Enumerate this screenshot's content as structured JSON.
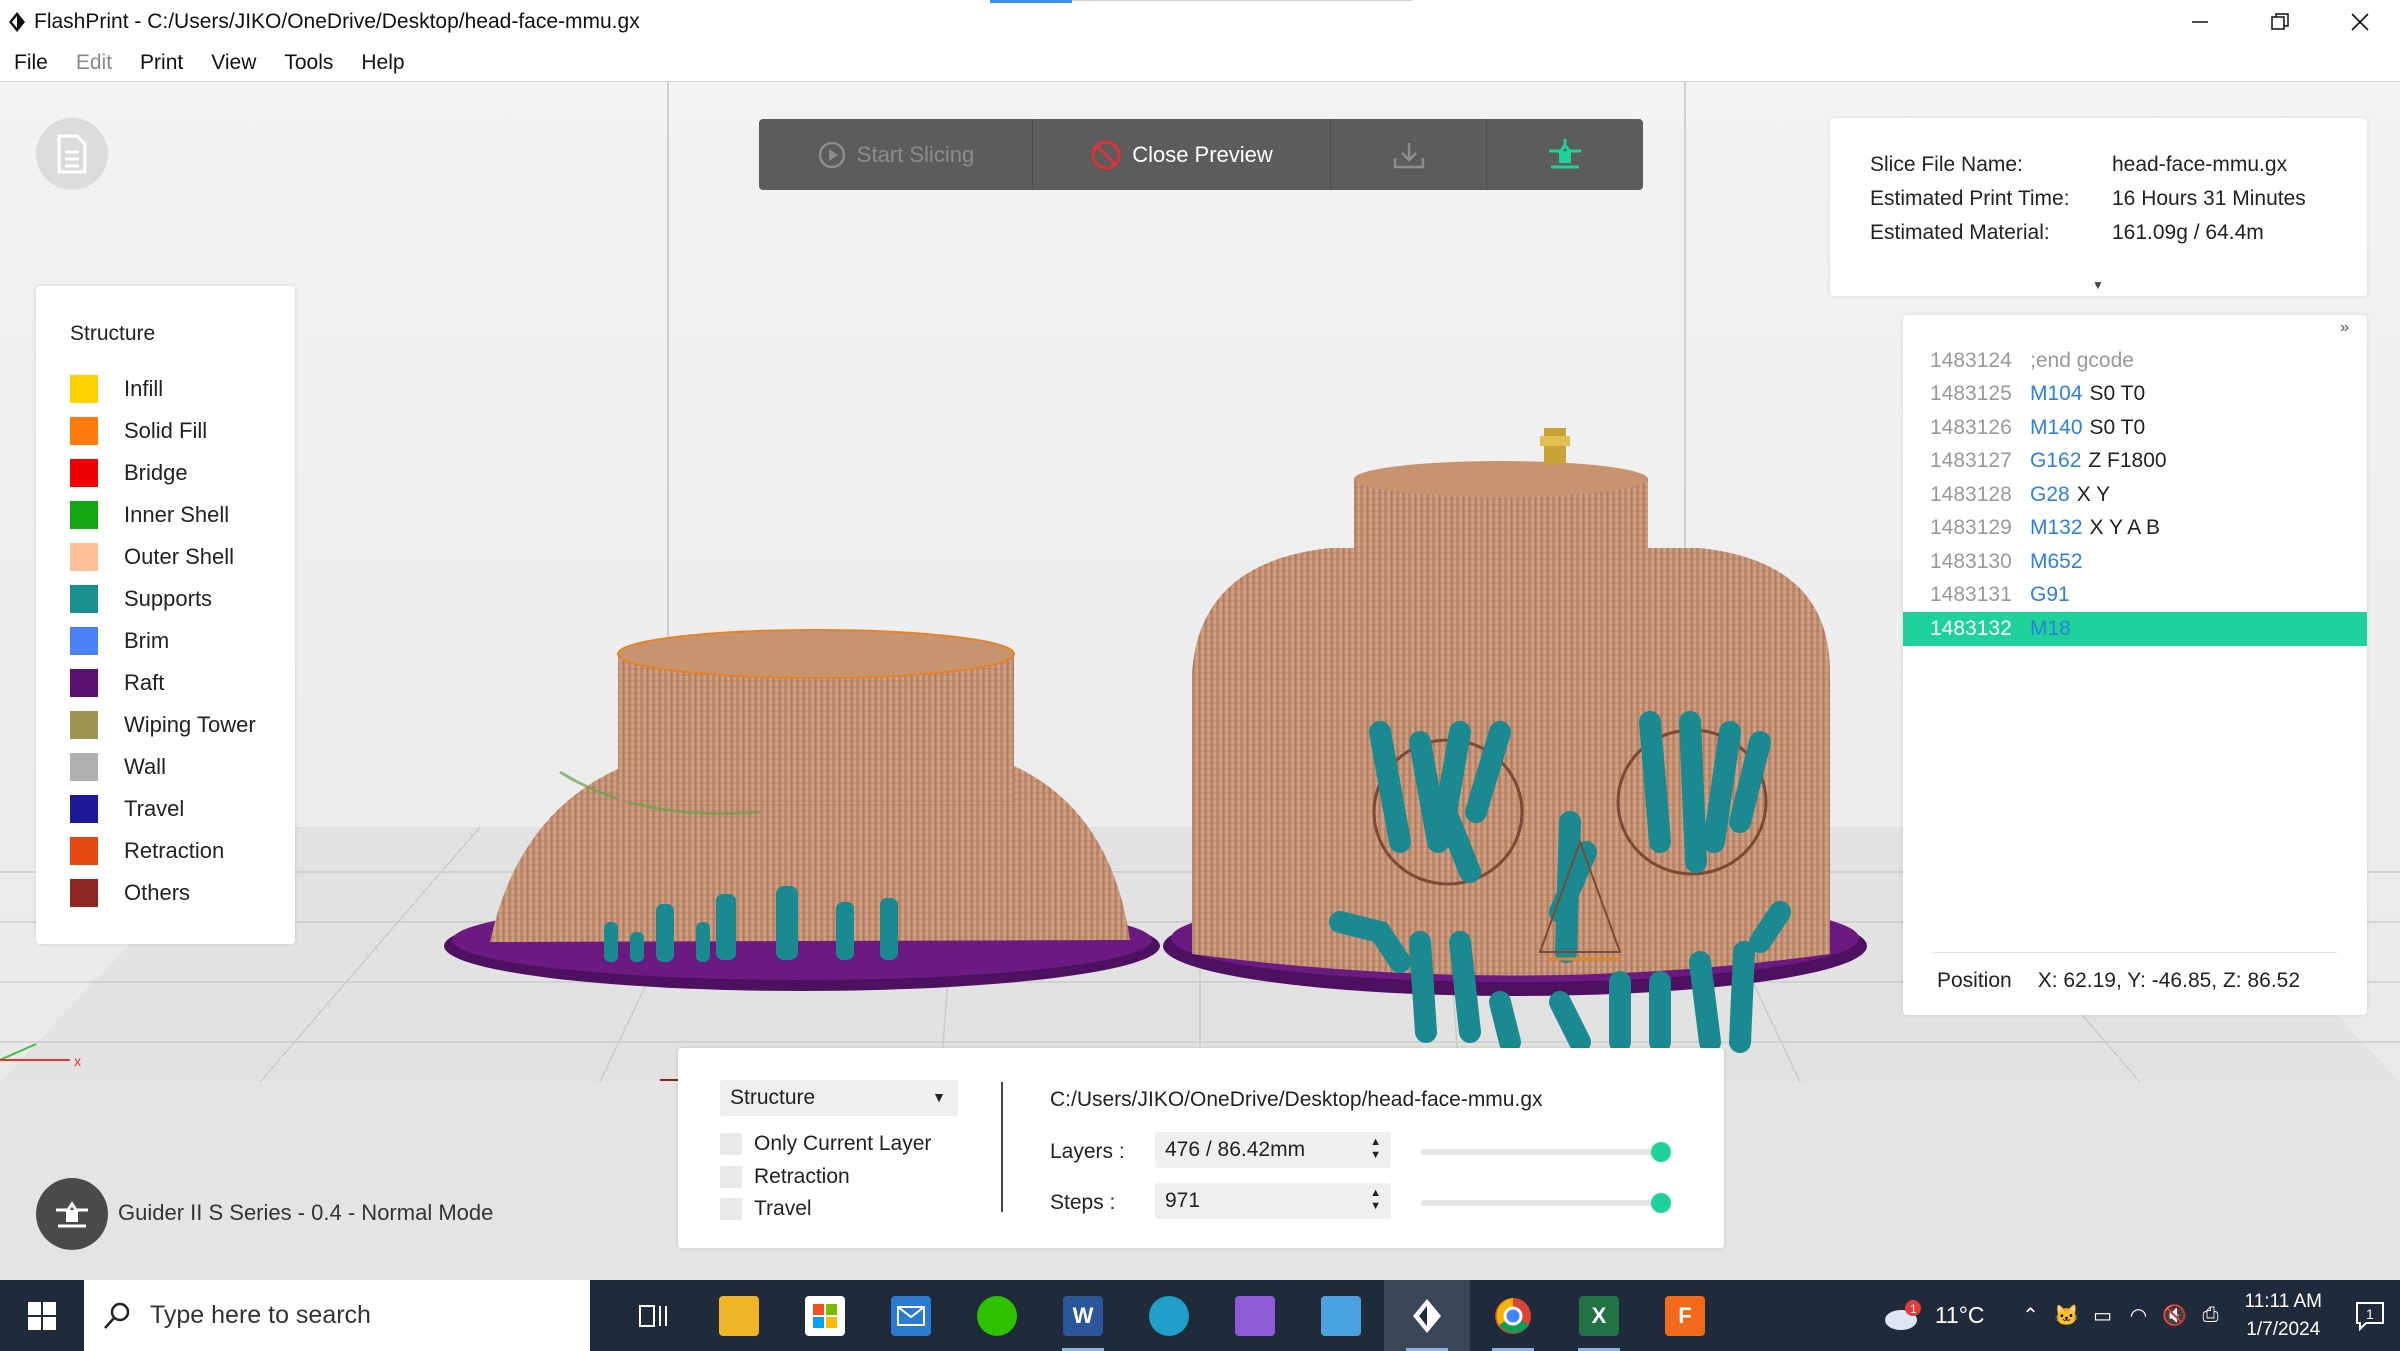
{
  "window": {
    "title": "FlashPrint - C:/Users/JIKO/OneDrive/Desktop/head-face-mmu.gx",
    "controls": [
      "minimize-icon",
      "restore-icon",
      "close-icon"
    ]
  },
  "menu": {
    "items": [
      "File",
      "Edit",
      "Print",
      "View",
      "Tools",
      "Help"
    ]
  },
  "toolbar": {
    "start_slicing": "Start Slicing",
    "close_preview": "Close Preview",
    "close_preview_icon_color": "#e0303a",
    "accent": "#1fd29a"
  },
  "legend": {
    "title": "Structure",
    "items": [
      {
        "label": "Infill",
        "color": "#ffd200"
      },
      {
        "label": "Solid Fill",
        "color": "#ff7a0a"
      },
      {
        "label": "Bridge",
        "color": "#f00000"
      },
      {
        "label": "Inner Shell",
        "color": "#13a813"
      },
      {
        "label": "Outer Shell",
        "color": "#ffbf98"
      },
      {
        "label": "Supports",
        "color": "#1a8f8f"
      },
      {
        "label": "Brim",
        "color": "#4a82f5"
      },
      {
        "label": "Raft",
        "color": "#5a1070"
      },
      {
        "label": "Wiping Tower",
        "color": "#9c9450"
      },
      {
        "label": "Wall",
        "color": "#b0b0b0"
      },
      {
        "label": "Travel",
        "color": "#1c1896"
      },
      {
        "label": "Retraction",
        "color": "#e64a10"
      },
      {
        "label": "Others",
        "color": "#8c2620"
      }
    ]
  },
  "slice_info": {
    "rows": [
      {
        "key": "Slice File Name:",
        "value": "head-face-mmu.gx"
      },
      {
        "key": "Estimated Print Time:",
        "value": "16 Hours 31 Minutes"
      },
      {
        "key": "Estimated Material:",
        "value": "161.09g / 64.4m"
      }
    ]
  },
  "gcode": {
    "lines": [
      {
        "num": "1483124",
        "cmd": "",
        "args": ";end gcode",
        "comment": true
      },
      {
        "num": "1483125",
        "cmd": "M104",
        "args": "S0 T0"
      },
      {
        "num": "1483126",
        "cmd": "M140",
        "args": "S0 T0"
      },
      {
        "num": "1483127",
        "cmd": "G162",
        "args": "Z F1800"
      },
      {
        "num": "1483128",
        "cmd": "G28",
        "args": "X Y"
      },
      {
        "num": "1483129",
        "cmd": "M132",
        "args": "X Y A B"
      },
      {
        "num": "1483130",
        "cmd": "M652",
        "args": ""
      },
      {
        "num": "1483131",
        "cmd": "G91",
        "args": ""
      },
      {
        "num": "1483132",
        "cmd": "M18",
        "args": "",
        "selected": true
      }
    ],
    "position_label": "Position",
    "position_value": "X: 62.19, Y: -46.85, Z: 86.52"
  },
  "printer": {
    "label": "Guider II S Series - 0.4 - Normal Mode"
  },
  "controls": {
    "mode": "Structure",
    "checks": [
      "Only Current Layer",
      "Retraction",
      "Travel"
    ],
    "file_path": "C:/Users/JIKO/OneDrive/Desktop/head-face-mmu.gx",
    "layers_label": "Layers :",
    "layers_value": "476 / 86.42mm",
    "steps_label": "Steps :",
    "steps_value": "971",
    "layers_slider": 1.0,
    "steps_slider": 1.0
  },
  "taskbar": {
    "search_placeholder": "Type here to search",
    "temperature": "11°C",
    "weather_badge": "1",
    "time": "11:11 AM",
    "date": "1/7/2024",
    "notification_count": "1"
  }
}
